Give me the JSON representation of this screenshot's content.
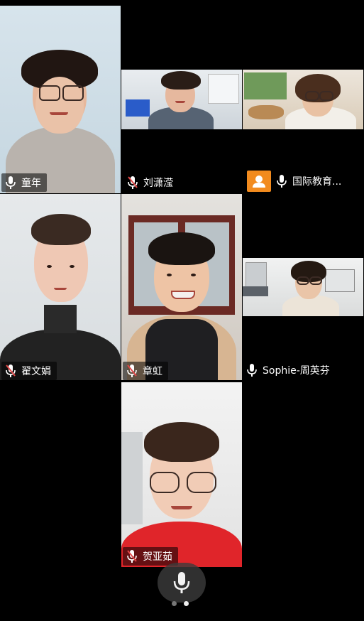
{
  "participants": [
    {
      "name": "童年",
      "muted": false
    },
    {
      "name": "刘潇滢",
      "muted": true
    },
    {
      "name": "国际教育...",
      "muted": false
    },
    {
      "name": "翟文娟",
      "muted": true
    },
    {
      "name": "章虹",
      "muted": true
    },
    {
      "name": "Sophie-周英芬",
      "muted": false
    },
    {
      "name": "贺亚茹",
      "muted": true
    }
  ],
  "pager": {
    "pages": 2,
    "current": 2
  },
  "colors": {
    "speaker_highlight": "#39d353",
    "muted_mic": "#e04848",
    "avatar_bg": "#f28b1e"
  }
}
